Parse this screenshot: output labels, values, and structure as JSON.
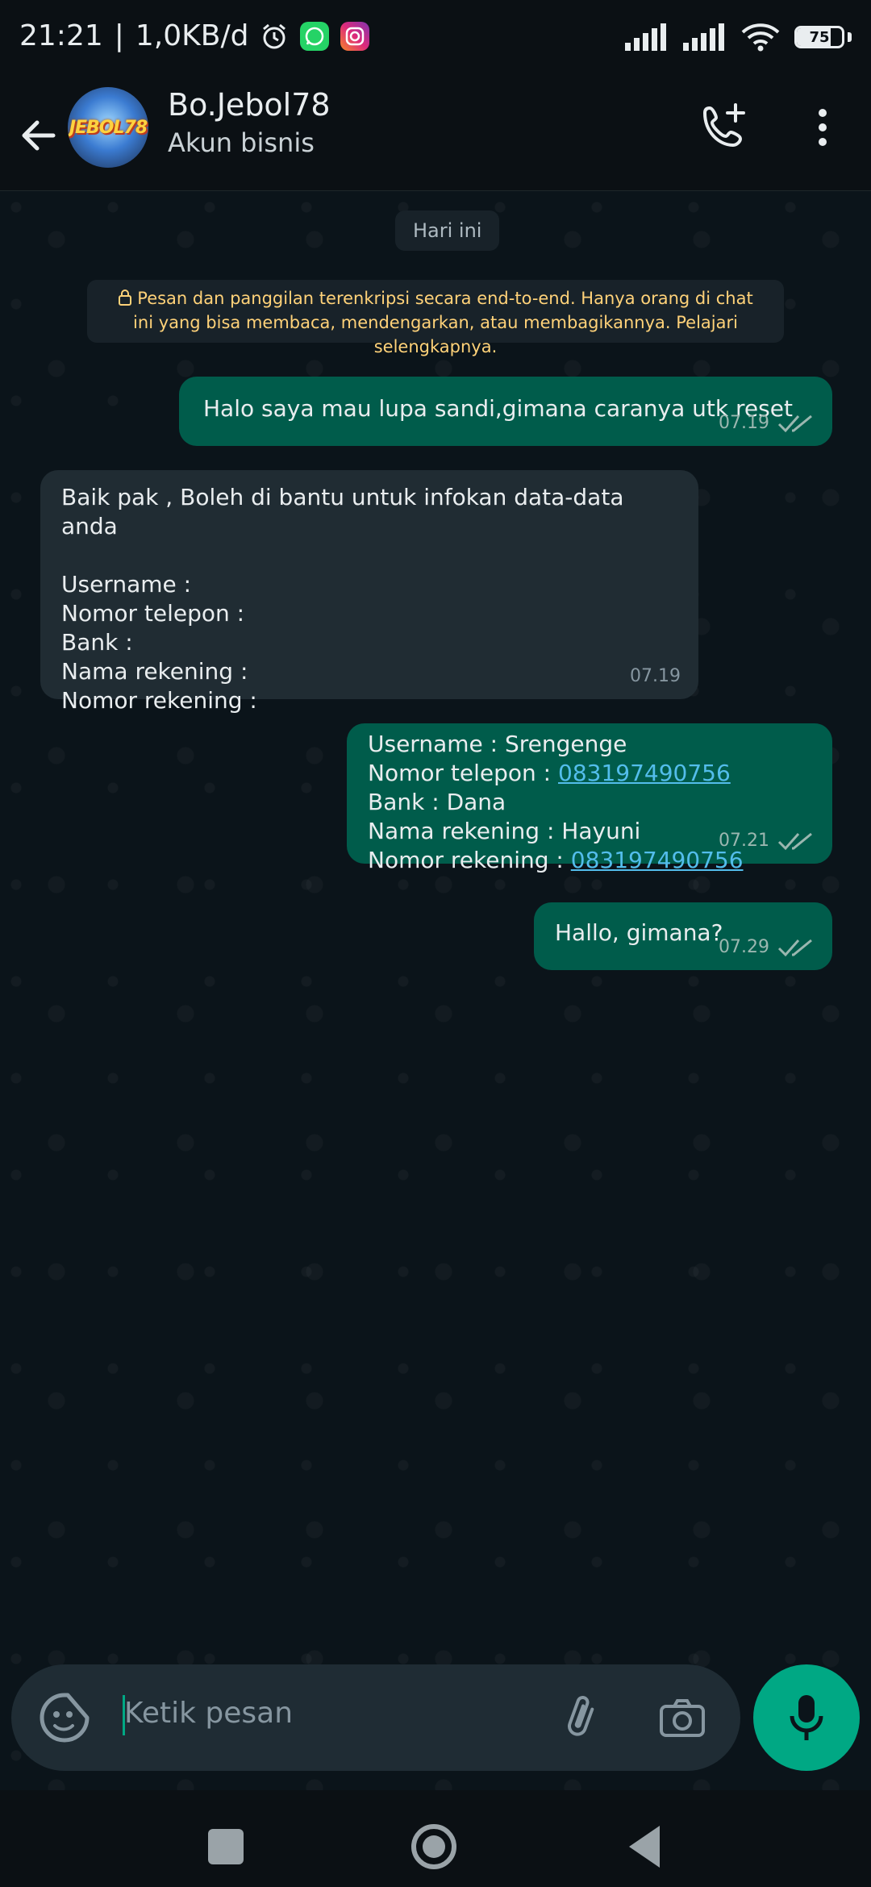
{
  "status_bar": {
    "time": "21:21",
    "speed": "1,0KB/d",
    "battery_text": "75",
    "battery_level_percent": 75
  },
  "header": {
    "contact_name": "Bo.Jebol78",
    "contact_subtitle": "Akun bisnis",
    "avatar_text": "JEBOL78"
  },
  "chat": {
    "date_chip": "Hari ini",
    "encryption_note": "Pesan dan panggilan terenkripsi secara end-to-end. Hanya orang di chat ini yang bisa membaca, mendengarkan, atau membagikannya. Pelajari selengkapnya.",
    "messages": [
      {
        "direction": "outgoing",
        "text": "Halo saya mau lupa sandi,gimana caranya utk reset",
        "time": "07.19",
        "status": "read"
      },
      {
        "direction": "incoming",
        "lines": [
          "Baik pak , Boleh di bantu untuk infokan data-data anda",
          "",
          "Username :",
          "Nomor telepon :",
          "Bank :",
          "Nama rekening :",
          "Nomor rekening :"
        ],
        "time": "07.19"
      },
      {
        "direction": "outgoing",
        "username_line": "Username : Srengenge",
        "phone_label": "Nomor telepon : ",
        "phone_link": "083197490756",
        "bank_line": "Bank : Dana",
        "name_line": "Nama rekening : Hayuni",
        "account_label": "Nomor rekening : ",
        "account_link": "083197490756",
        "time": "07.21",
        "status": "read"
      },
      {
        "direction": "outgoing",
        "text": "Hallo, gimana?",
        "time": "07.29",
        "status": "read"
      }
    ]
  },
  "composer": {
    "placeholder": "Ketik pesan"
  },
  "icons": {
    "back": "arrow-left-icon",
    "call_add": "phone-plus-icon",
    "menu": "more-vertical-icon",
    "lock": "lock-icon",
    "read": "double-check-icon",
    "emoji": "sticker-icon",
    "attach": "paperclip-icon",
    "camera": "camera-icon",
    "mic": "mic-icon"
  },
  "colors": {
    "outgoing_bubble": "#005c4b",
    "incoming_bubble": "#202c33",
    "accent": "#00a884",
    "link": "#53bdeb",
    "note_text": "#ffd279"
  }
}
